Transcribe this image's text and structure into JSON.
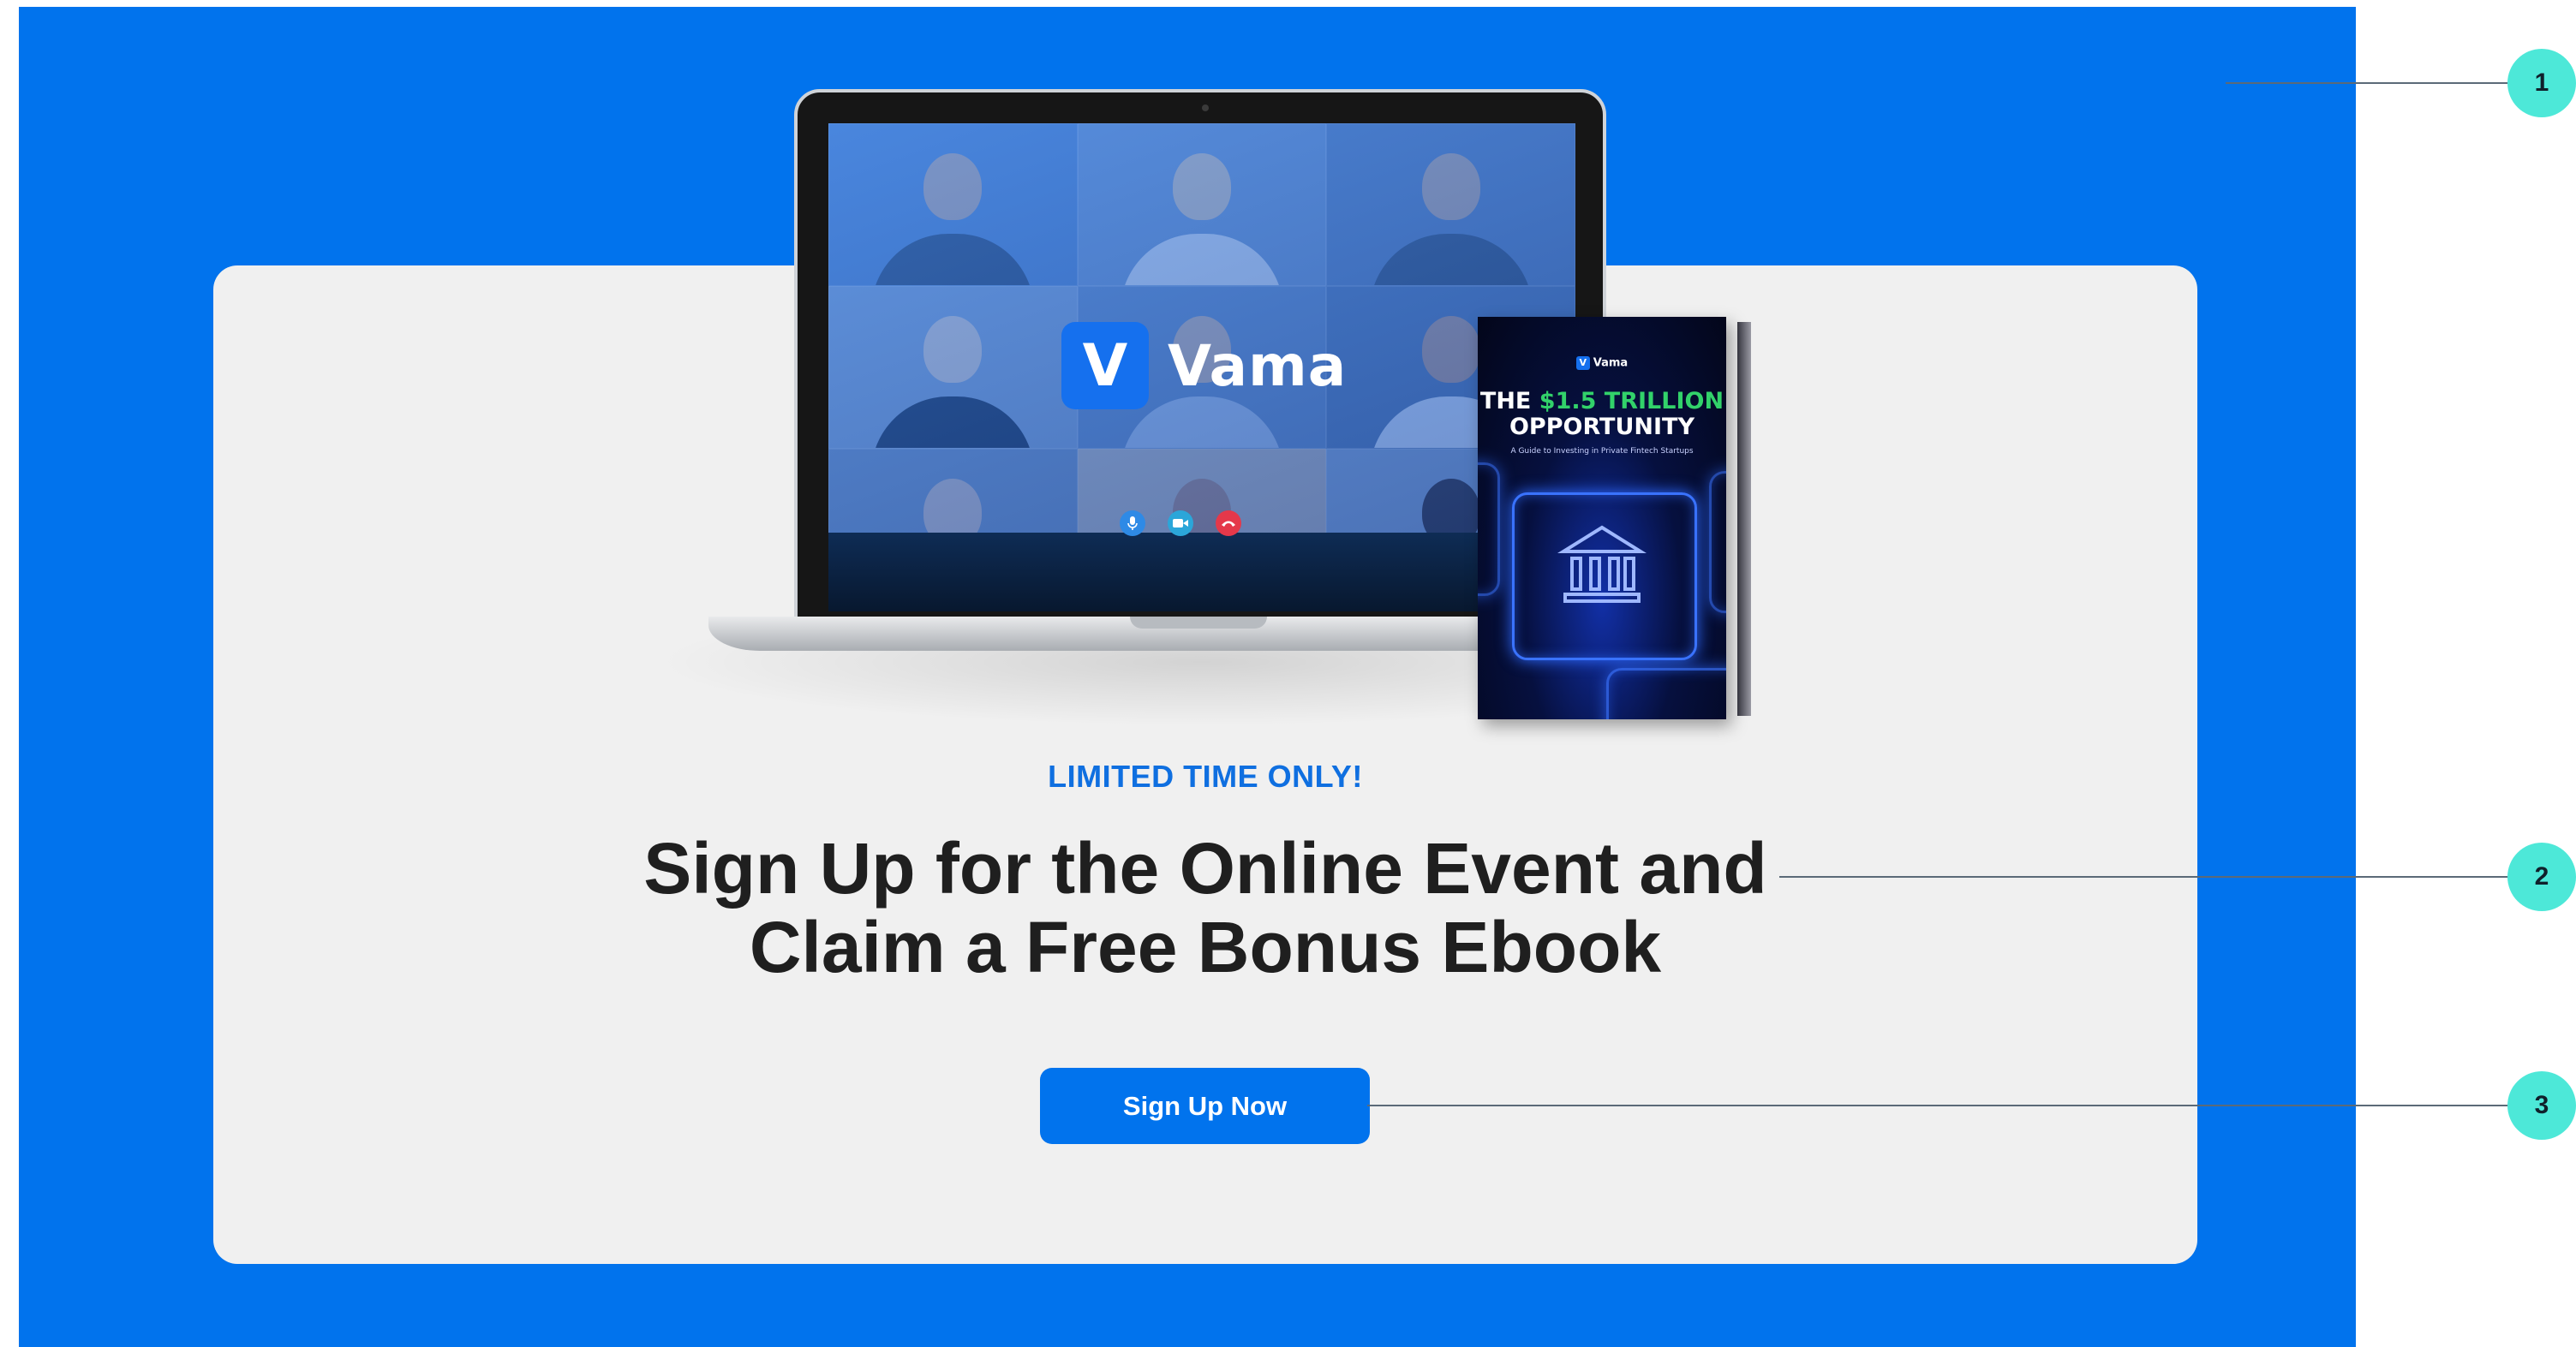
{
  "banner": {
    "eyebrow": "LIMITED TIME ONLY!",
    "headline_line1": "Sign Up for the Online Event and",
    "headline_line2": "Claim a Free Bonus Ebook",
    "cta_label": "Sign Up Now",
    "background_color": "#0173ED",
    "card_color": "#F0F0F0"
  },
  "laptop_screen": {
    "brand_logo_glyph": "V",
    "brand_name": "Vama",
    "call_controls": [
      "microphone-icon",
      "video-camera-icon",
      "end-call-icon"
    ]
  },
  "ebook": {
    "brand_logo_glyph": "V",
    "brand_name": "Vama",
    "title_prefix": "THE ",
    "title_accent": "$1.5 TRILLION",
    "title_line2": "OPPORTUNITY",
    "subtitle": "A Guide to Investing in Private Fintech Startups",
    "accent_color": "#32D26A"
  },
  "annotations": {
    "markers": [
      "1",
      "2",
      "3"
    ],
    "marker_color": "#4DE8D8"
  }
}
